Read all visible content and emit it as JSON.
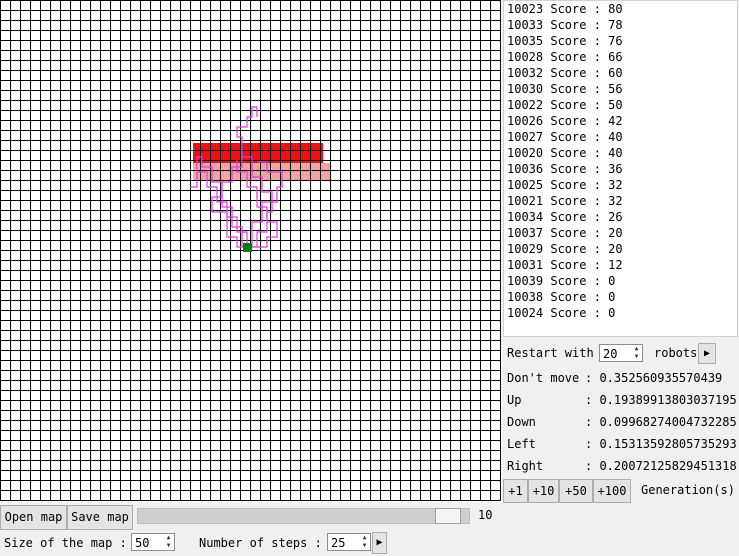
{
  "scores": [
    {
      "id": "10023",
      "label": "Score",
      "value": "80"
    },
    {
      "id": "10033",
      "label": "Score",
      "value": "78"
    },
    {
      "id": "10035",
      "label": "Score",
      "value": "76"
    },
    {
      "id": "10028",
      "label": "Score",
      "value": "66"
    },
    {
      "id": "10032",
      "label": "Score",
      "value": "60"
    },
    {
      "id": "10030",
      "label": "Score",
      "value": "56"
    },
    {
      "id": "10022",
      "label": "Score",
      "value": "50"
    },
    {
      "id": "10026",
      "label": "Score",
      "value": "42"
    },
    {
      "id": "10027",
      "label": "Score",
      "value": "40"
    },
    {
      "id": "10020",
      "label": "Score",
      "value": "40"
    },
    {
      "id": "10036",
      "label": "Score",
      "value": "36"
    },
    {
      "id": "10025",
      "label": "Score",
      "value": "32"
    },
    {
      "id": "10021",
      "label": "Score",
      "value": "32"
    },
    {
      "id": "10034",
      "label": "Score",
      "value": "26"
    },
    {
      "id": "10037",
      "label": "Score",
      "value": "20"
    },
    {
      "id": "10029",
      "label": "Score",
      "value": "20"
    },
    {
      "id": "10031",
      "label": "Score",
      "value": "12"
    },
    {
      "id": "10039",
      "label": "Score",
      "value": "0"
    },
    {
      "id": "10038",
      "label": "Score",
      "value": "0"
    },
    {
      "id": "10024",
      "label": "Score",
      "value": "0"
    }
  ],
  "restart": {
    "label": "Restart with",
    "count": "20",
    "suffix": "robots",
    "play_icon": "play-icon"
  },
  "probabilities": [
    {
      "name": "Don't move",
      "value": "0.352560935570439"
    },
    {
      "name": "Up",
      "value": "0.1938991380303719​5"
    },
    {
      "name": "Down",
      "value": "0.09968274004732285"
    },
    {
      "name": "Left",
      "value": "0.15313592805735293"
    },
    {
      "name": "Right",
      "value": "0.20072125829451318"
    }
  ],
  "generations": {
    "buttons": [
      "+1",
      "+10",
      "+50",
      "+100"
    ],
    "label": "Generation(s)"
  },
  "file": {
    "open": "Open map",
    "save": "Save map"
  },
  "slider": {
    "value": "10",
    "level_fraction": 0.97
  },
  "settings": {
    "size_label": "Size of the map :",
    "size_value": "50",
    "steps_label": "Number of steps :",
    "steps_value": "25"
  },
  "colors": {
    "wall": "#ee1111",
    "goal_zone": "#f4a3a3",
    "trail": "#e23ce2",
    "robot": "#008000",
    "grid": "#000000"
  }
}
